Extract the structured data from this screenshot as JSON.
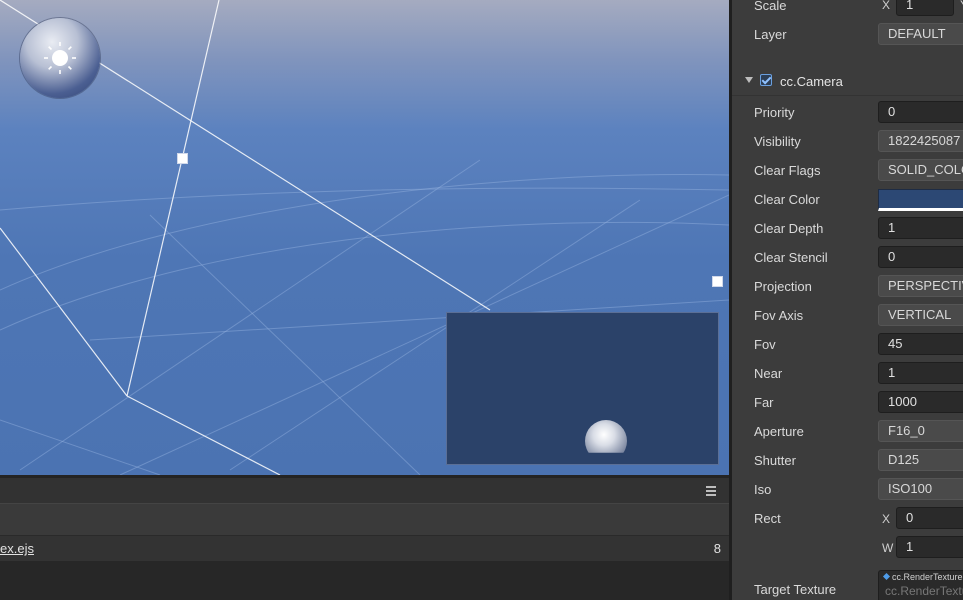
{
  "inspector": {
    "scale": {
      "label": "Scale",
      "x_axis": "X",
      "x_value": "1",
      "y_axis": "Y"
    },
    "layer": {
      "label": "Layer",
      "value": "DEFAULT"
    },
    "component": {
      "title": "cc.Camera",
      "enabled": true
    },
    "properties": [
      {
        "label": "Priority",
        "value": "0",
        "kind": "number"
      },
      {
        "label": "Visibility",
        "value": "1822425087",
        "kind": "select"
      },
      {
        "label": "Clear Flags",
        "value": "SOLID_COLOR",
        "kind": "select"
      },
      {
        "label": "Clear Color",
        "value": "",
        "kind": "color"
      },
      {
        "label": "Clear Depth",
        "value": "1",
        "kind": "number"
      },
      {
        "label": "Clear Stencil",
        "value": "0",
        "kind": "number"
      },
      {
        "label": "Projection",
        "value": "PERSPECTIVE",
        "kind": "select"
      },
      {
        "label": "Fov Axis",
        "value": "VERTICAL",
        "kind": "select"
      },
      {
        "label": "Fov",
        "value": "45",
        "kind": "number"
      },
      {
        "label": "Near",
        "value": "1",
        "kind": "number"
      },
      {
        "label": "Far",
        "value": "1000",
        "kind": "number"
      },
      {
        "label": "Aperture",
        "value": "F16_0",
        "kind": "select"
      },
      {
        "label": "Shutter",
        "value": "D125",
        "kind": "select"
      },
      {
        "label": "Iso",
        "value": "ISO100",
        "kind": "select"
      }
    ],
    "rect": {
      "label": "Rect",
      "x_axis": "X",
      "x_value": "0",
      "w_axis": "W",
      "w_value": "1"
    },
    "target_texture": {
      "label": "Target Texture",
      "type": "cc.RenderTexture",
      "placeholder": "cc.RenderTexture"
    }
  },
  "console": {
    "file": "ex.ejs",
    "count": "8",
    "menu_icon": "hamburger-menu-icon"
  },
  "scene": {
    "gizmo_icon": "sun-icon",
    "clear_color": "#2c4874",
    "sky_color": "#4e76b5"
  }
}
